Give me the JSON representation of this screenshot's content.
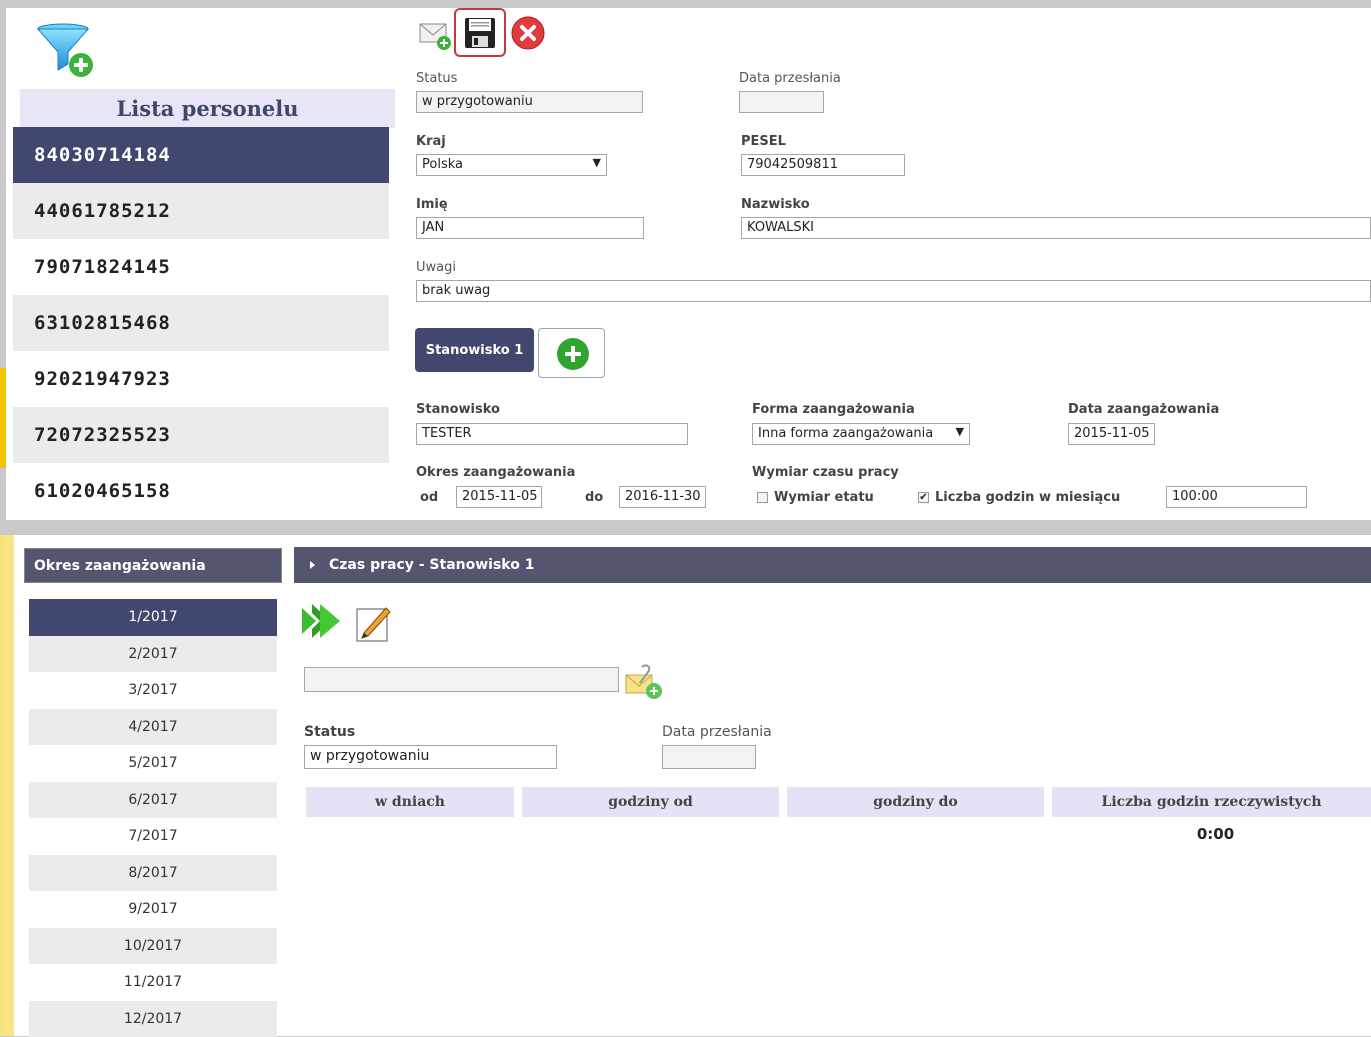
{
  "personnel": {
    "title": "Lista personelu",
    "items": [
      "84030714184",
      "44061785212",
      "79071824145",
      "63102815468",
      "92021947923",
      "72072325523",
      "61020465158"
    ],
    "active_index": 0
  },
  "toolbar": {
    "icons": [
      "send-mail-icon",
      "save-icon",
      "delete-icon"
    ]
  },
  "form": {
    "status_label": "Status",
    "status_value": "w przygotowaniu",
    "data_przeslania_label": "Data przesłania",
    "data_przeslania_value": "",
    "kraj_label": "Kraj",
    "kraj_value": "Polska",
    "pesel_label": "PESEL",
    "pesel_value": "79042509811",
    "imie_label": "Imię",
    "imie_value": "JAN",
    "nazwisko_label": "Nazwisko",
    "nazwisko_value": "KOWALSKI",
    "uwagi_label": "Uwagi",
    "uwagi_value": "brak uwag"
  },
  "position": {
    "tab_label": "Stanowisko 1",
    "stanowisko_label": "Stanowisko",
    "stanowisko_value": "TESTER",
    "forma_label": "Forma zaangażowania",
    "forma_value": "Inna forma zaangażowania",
    "data_zaang_label": "Data zaangażowania",
    "data_zaang_value": "2015-11-05",
    "okres_label": "Okres zaangażowania",
    "od_label": "od",
    "od_value": "2015-11-05",
    "do_label": "do",
    "do_value": "2016-11-30",
    "wymiar_label": "Wymiar czasu pracy",
    "wymiar_etatu_label": "Wymiar etatu",
    "wymiar_etatu_checked": false,
    "liczba_godzin_label": "Liczba godzin w miesiącu",
    "liczba_godzin_checked": true,
    "liczba_godzin_value": "100:00"
  },
  "periods": {
    "header": "Okres zaangażowania",
    "items": [
      "1/2017",
      "2/2017",
      "3/2017",
      "4/2017",
      "5/2017",
      "6/2017",
      "7/2017",
      "8/2017",
      "9/2017",
      "10/2017",
      "11/2017",
      "12/2017"
    ],
    "active_index": 0
  },
  "worktime": {
    "header": "Czas pracy - Stanowisko 1",
    "status_label": "Status",
    "status_value": "w przygotowaniu",
    "data_przeslania_label": "Data przesłania",
    "data_przeslania_value": "",
    "attachment_value": "",
    "columns": [
      "w dniach",
      "godziny od",
      "godziny do",
      "Liczba godzin rzeczywistych"
    ],
    "total": "0:00"
  }
}
